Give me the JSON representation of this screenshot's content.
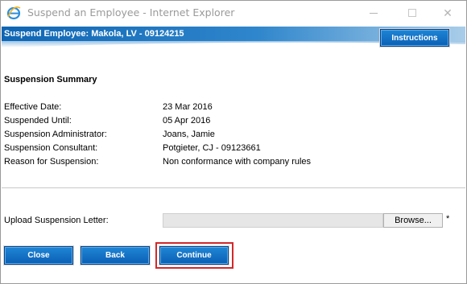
{
  "window": {
    "title": "Suspend an Employee - Internet Explorer",
    "close_glyph": "✕"
  },
  "header": {
    "title": "Suspend Employee: Makola, LV - 09124215",
    "instructions_label": "Instructions"
  },
  "summary": {
    "heading": "Suspension Summary",
    "rows": [
      {
        "label": "Effective Date:",
        "value": "23 Mar 2016"
      },
      {
        "label": "Suspended Until:",
        "value": "05 Apr 2016"
      },
      {
        "label": "Suspension Administrator:",
        "value": "Joans, Jamie"
      },
      {
        "label": "Suspension Consultant:",
        "value": "Potgieter, CJ - 09123661"
      },
      {
        "label": "Reason for Suspension:",
        "value": "Non conformance with company rules"
      }
    ]
  },
  "upload": {
    "label": "Upload Suspension Letter:",
    "value": "",
    "browse_label": "Browse...",
    "required_mark": "*"
  },
  "actions": {
    "close_label": "Close",
    "back_label": "Back",
    "continue_label": "Continue"
  },
  "colors": {
    "button_blue": "#0b5fb5",
    "header_band": "#1a74c4",
    "highlight_red": "#d2282a"
  }
}
